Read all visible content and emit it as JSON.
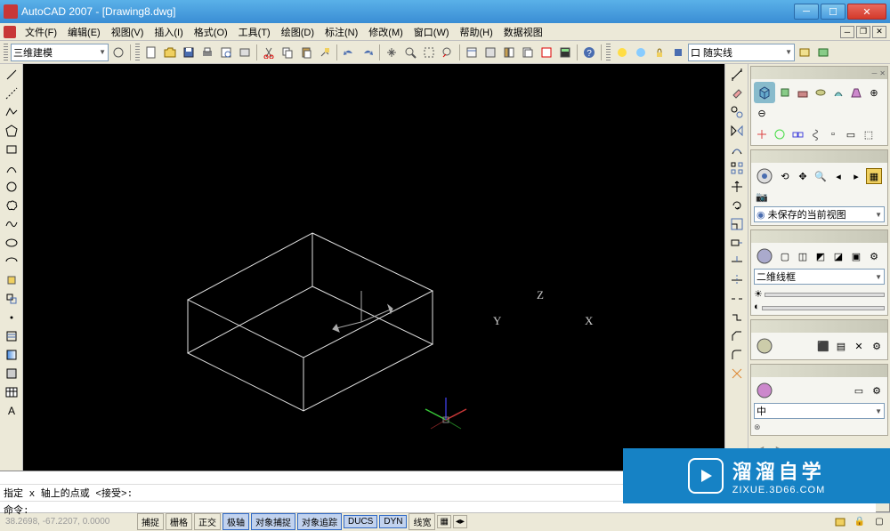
{
  "title": "AutoCAD 2007 - [Drawing8.dwg]",
  "menu": [
    "文件(F)",
    "编辑(E)",
    "视图(V)",
    "插入(I)",
    "格式(O)",
    "工具(T)",
    "绘图(D)",
    "标注(N)",
    "修改(M)",
    "窗口(W)",
    "帮助(H)",
    "数据视图"
  ],
  "workspace": "三维建模",
  "layer_state": "口 随实线",
  "right_panel": {
    "view_state": "未保存的当前视图",
    "visual_style": "二维线框",
    "coord_sys": "中"
  },
  "command": {
    "line1": "指定 x 轴上的点或 <接受>:",
    "line2": "命令:"
  },
  "status": {
    "coords": "38.2698, -67.2207, 0.0000",
    "buttons": [
      "捕捉",
      "栅格",
      "正交",
      "极轴",
      "对象捕捉",
      "对象追踪",
      "DUCS",
      "DYN",
      "线宽"
    ]
  },
  "axis": {
    "x": "X",
    "y": "Y",
    "z": "Z"
  },
  "watermark": {
    "title": "溜溜自学",
    "url": "ZIXUE.3D66.COM"
  }
}
